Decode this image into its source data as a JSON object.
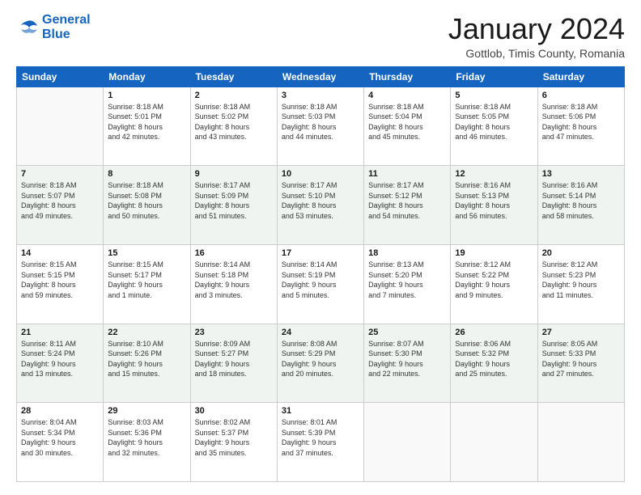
{
  "header": {
    "logo_line1": "General",
    "logo_line2": "Blue",
    "month_title": "January 2024",
    "location": "Gottlob, Timis County, Romania"
  },
  "weekdays": [
    "Sunday",
    "Monday",
    "Tuesday",
    "Wednesday",
    "Thursday",
    "Friday",
    "Saturday"
  ],
  "weeks": [
    [
      {
        "num": "",
        "info": ""
      },
      {
        "num": "1",
        "info": "Sunrise: 8:18 AM\nSunset: 5:01 PM\nDaylight: 8 hours\nand 42 minutes."
      },
      {
        "num": "2",
        "info": "Sunrise: 8:18 AM\nSunset: 5:02 PM\nDaylight: 8 hours\nand 43 minutes."
      },
      {
        "num": "3",
        "info": "Sunrise: 8:18 AM\nSunset: 5:03 PM\nDaylight: 8 hours\nand 44 minutes."
      },
      {
        "num": "4",
        "info": "Sunrise: 8:18 AM\nSunset: 5:04 PM\nDaylight: 8 hours\nand 45 minutes."
      },
      {
        "num": "5",
        "info": "Sunrise: 8:18 AM\nSunset: 5:05 PM\nDaylight: 8 hours\nand 46 minutes."
      },
      {
        "num": "6",
        "info": "Sunrise: 8:18 AM\nSunset: 5:06 PM\nDaylight: 8 hours\nand 47 minutes."
      }
    ],
    [
      {
        "num": "7",
        "info": "Sunrise: 8:18 AM\nSunset: 5:07 PM\nDaylight: 8 hours\nand 49 minutes."
      },
      {
        "num": "8",
        "info": "Sunrise: 8:18 AM\nSunset: 5:08 PM\nDaylight: 8 hours\nand 50 minutes."
      },
      {
        "num": "9",
        "info": "Sunrise: 8:17 AM\nSunset: 5:09 PM\nDaylight: 8 hours\nand 51 minutes."
      },
      {
        "num": "10",
        "info": "Sunrise: 8:17 AM\nSunset: 5:10 PM\nDaylight: 8 hours\nand 53 minutes."
      },
      {
        "num": "11",
        "info": "Sunrise: 8:17 AM\nSunset: 5:12 PM\nDaylight: 8 hours\nand 54 minutes."
      },
      {
        "num": "12",
        "info": "Sunrise: 8:16 AM\nSunset: 5:13 PM\nDaylight: 8 hours\nand 56 minutes."
      },
      {
        "num": "13",
        "info": "Sunrise: 8:16 AM\nSunset: 5:14 PM\nDaylight: 8 hours\nand 58 minutes."
      }
    ],
    [
      {
        "num": "14",
        "info": "Sunrise: 8:15 AM\nSunset: 5:15 PM\nDaylight: 8 hours\nand 59 minutes."
      },
      {
        "num": "15",
        "info": "Sunrise: 8:15 AM\nSunset: 5:17 PM\nDaylight: 9 hours\nand 1 minute."
      },
      {
        "num": "16",
        "info": "Sunrise: 8:14 AM\nSunset: 5:18 PM\nDaylight: 9 hours\nand 3 minutes."
      },
      {
        "num": "17",
        "info": "Sunrise: 8:14 AM\nSunset: 5:19 PM\nDaylight: 9 hours\nand 5 minutes."
      },
      {
        "num": "18",
        "info": "Sunrise: 8:13 AM\nSunset: 5:20 PM\nDaylight: 9 hours\nand 7 minutes."
      },
      {
        "num": "19",
        "info": "Sunrise: 8:12 AM\nSunset: 5:22 PM\nDaylight: 9 hours\nand 9 minutes."
      },
      {
        "num": "20",
        "info": "Sunrise: 8:12 AM\nSunset: 5:23 PM\nDaylight: 9 hours\nand 11 minutes."
      }
    ],
    [
      {
        "num": "21",
        "info": "Sunrise: 8:11 AM\nSunset: 5:24 PM\nDaylight: 9 hours\nand 13 minutes."
      },
      {
        "num": "22",
        "info": "Sunrise: 8:10 AM\nSunset: 5:26 PM\nDaylight: 9 hours\nand 15 minutes."
      },
      {
        "num": "23",
        "info": "Sunrise: 8:09 AM\nSunset: 5:27 PM\nDaylight: 9 hours\nand 18 minutes."
      },
      {
        "num": "24",
        "info": "Sunrise: 8:08 AM\nSunset: 5:29 PM\nDaylight: 9 hours\nand 20 minutes."
      },
      {
        "num": "25",
        "info": "Sunrise: 8:07 AM\nSunset: 5:30 PM\nDaylight: 9 hours\nand 22 minutes."
      },
      {
        "num": "26",
        "info": "Sunrise: 8:06 AM\nSunset: 5:32 PM\nDaylight: 9 hours\nand 25 minutes."
      },
      {
        "num": "27",
        "info": "Sunrise: 8:05 AM\nSunset: 5:33 PM\nDaylight: 9 hours\nand 27 minutes."
      }
    ],
    [
      {
        "num": "28",
        "info": "Sunrise: 8:04 AM\nSunset: 5:34 PM\nDaylight: 9 hours\nand 30 minutes."
      },
      {
        "num": "29",
        "info": "Sunrise: 8:03 AM\nSunset: 5:36 PM\nDaylight: 9 hours\nand 32 minutes."
      },
      {
        "num": "30",
        "info": "Sunrise: 8:02 AM\nSunset: 5:37 PM\nDaylight: 9 hours\nand 35 minutes."
      },
      {
        "num": "31",
        "info": "Sunrise: 8:01 AM\nSunset: 5:39 PM\nDaylight: 9 hours\nand 37 minutes."
      },
      {
        "num": "",
        "info": ""
      },
      {
        "num": "",
        "info": ""
      },
      {
        "num": "",
        "info": ""
      }
    ]
  ]
}
